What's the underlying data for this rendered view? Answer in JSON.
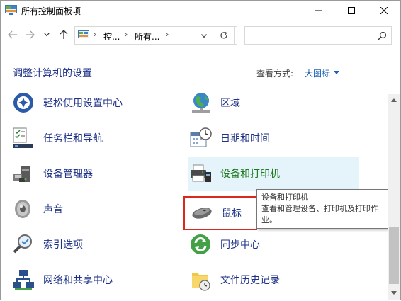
{
  "window": {
    "title": "所有控制面板项"
  },
  "nav": {
    "address_segments": [
      "控...",
      "所有..."
    ],
    "search_placeholder": ""
  },
  "header": {
    "heading": "调整计算机的设置",
    "view_by_label": "查看方式:",
    "view_by_value": "大图标"
  },
  "items": [
    {
      "label": "轻松使用设置中心",
      "icon": "ease-of-access-icon"
    },
    {
      "label": "区域",
      "icon": "globe-icon"
    },
    {
      "label": "任务栏和导航",
      "icon": "taskbar-icon"
    },
    {
      "label": "日期和时间",
      "icon": "calendar-clock-icon"
    },
    {
      "label": "设备管理器",
      "icon": "device-manager-icon"
    },
    {
      "label": "设备和打印机",
      "icon": "printer-icon"
    },
    {
      "label": "声音",
      "icon": "speaker-icon"
    },
    {
      "label": "鼠标",
      "icon": "mouse-icon"
    },
    {
      "label": "索引选项",
      "icon": "indexing-icon"
    },
    {
      "label": "同步中心",
      "icon": "sync-icon"
    },
    {
      "label": "网络和共享中心",
      "icon": "network-icon"
    },
    {
      "label": "文件历史记录",
      "icon": "file-history-icon"
    }
  ],
  "tooltip": {
    "title": "设备和打印机",
    "description": "查看和管理设备、打印机及打印作业。"
  },
  "colors": {
    "link": "#1e3287",
    "highlight_border": "#d9291c",
    "hover_bg": "#e5f3fb"
  }
}
